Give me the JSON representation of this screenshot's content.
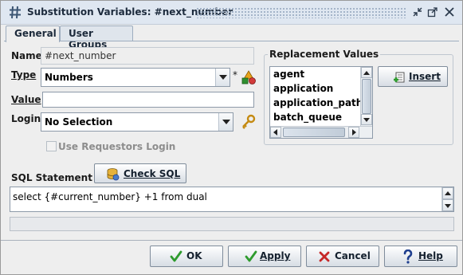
{
  "window": {
    "title": "Substitution Variables: #next_number",
    "icon": "hash-icon",
    "controls": [
      "restore-icon",
      "maximize-icon",
      "close-icon"
    ]
  },
  "tabs": [
    {
      "label": "General",
      "active": true
    },
    {
      "label": "User Groups",
      "active": false
    }
  ],
  "form": {
    "name_label": "Name",
    "name_value": "#next_number",
    "type_label": "Type",
    "type_value": "Numbers",
    "type_required_marker": "*",
    "value_label": "Value",
    "value_value": "",
    "login_label": "Login",
    "login_value": "No Selection",
    "use_requestors_login_label": "Use Requestors Login",
    "use_requestors_login_checked": false,
    "sql_label": "SQL Statement",
    "check_sql_label": "Check SQL",
    "sql_value": "select {#current_number} +1 from dual"
  },
  "replacement": {
    "title": "Replacement Values",
    "items": [
      "agent",
      "application",
      "application_path",
      "batch_queue"
    ],
    "insert_label": "Insert"
  },
  "buttons": {
    "ok": "OK",
    "apply": "Apply",
    "cancel": "Cancel",
    "help": "Help"
  },
  "colors": {
    "title_bar": "#dfe7f1",
    "dialog_bg": "#eeeeee",
    "ok_check": "#2e9b2e",
    "cancel_x": "#c62828",
    "help_mark": "#1f3f8f"
  }
}
